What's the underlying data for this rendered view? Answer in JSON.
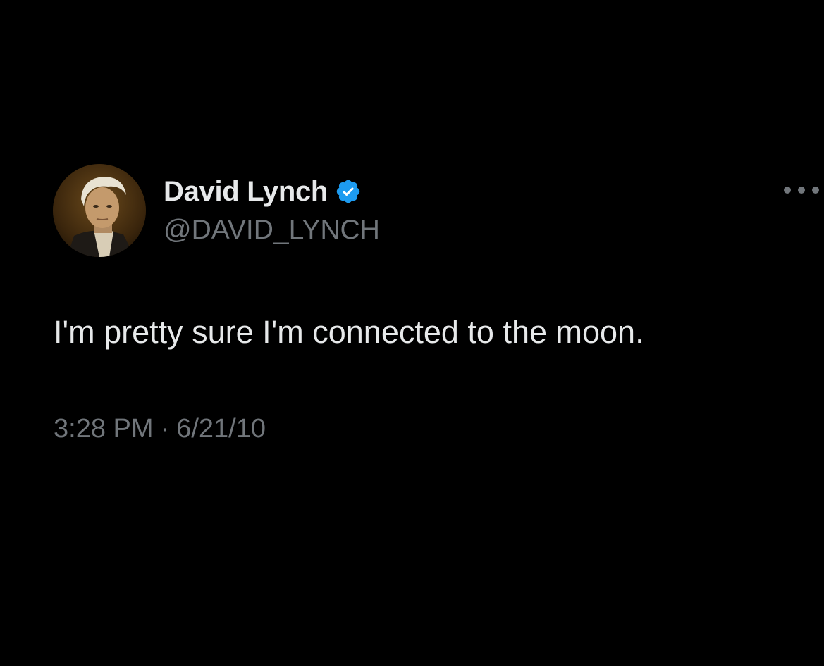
{
  "tweet": {
    "author": {
      "display_name": "David Lynch",
      "handle": "@DAVID_LYNCH",
      "verified": true,
      "avatar_icon": "profile-photo"
    },
    "text": "I'm pretty sure I'm connected to the moon.",
    "time": "3:28 PM",
    "separator": "·",
    "date": "6/21/10",
    "more_icon": "more-dots-icon"
  },
  "colors": {
    "background": "#000000",
    "primary_text": "#e7e9ea",
    "secondary_text": "#71767b",
    "verified_badge": "#1d9bf0"
  }
}
